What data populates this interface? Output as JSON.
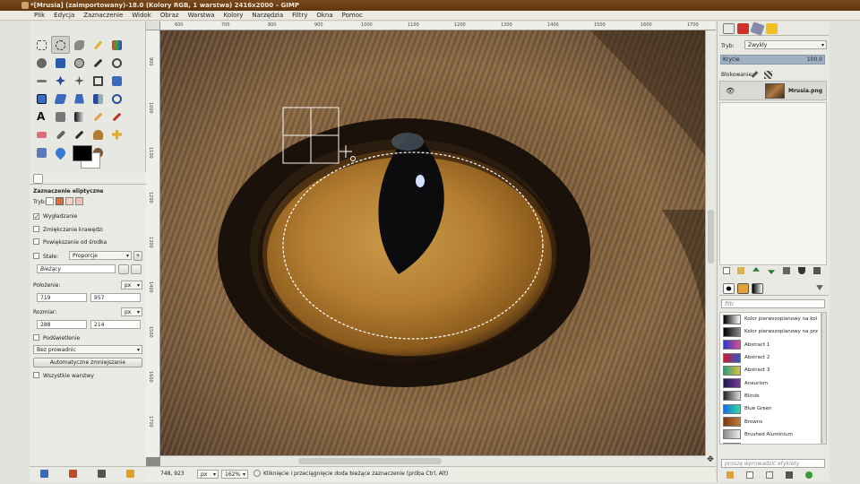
{
  "window": {
    "title": "*[Mrusia] (zaimportowany)-18.0 (Kolory RGB, 1 warstwa) 2416x2000 – GIMP"
  },
  "menu": [
    "Plik",
    "Edycja",
    "Zaznaczenie",
    "Widok",
    "Obraz",
    "Warstwa",
    "Kolory",
    "Narzędzia",
    "Filtry",
    "Okna",
    "Pomoc"
  ],
  "colors": {
    "accent": "#e2a23a",
    "titlebar": "#5c3510"
  },
  "tool_options": {
    "header": "Zaznaczenie eliptyczne",
    "mode_label": "Tryb:",
    "antialias_label": "Wygładzanie",
    "antialias_checked": true,
    "feather_label": "Zmiękczanie krawędzi",
    "expand_label": "Powiększanie od środka",
    "fixed_label": "Stałe:",
    "fixed_value": "Proporcje",
    "current_value": "Bieżący",
    "position_label": "Położenie:",
    "pos_x": "719",
    "pos_y": "957",
    "unit": "px",
    "size_label": "Rozmiar:",
    "size_w": "288",
    "size_h": "214",
    "highlight_label": "Podświetlenie",
    "guides_value": "Bez prowadnic",
    "autoshrink_button": "Automatyczne zmniejszanie",
    "all_layers_label": "Wszystkie warstwy"
  },
  "rulers": {
    "h": [
      "600",
      "700",
      "800",
      "900",
      "1000",
      "1100",
      "1200",
      "1300",
      "1400",
      "1500",
      "1600",
      "1700"
    ],
    "v": [
      "900",
      "1000",
      "1100",
      "1200",
      "1300",
      "1400",
      "1500",
      "1600",
      "1700",
      "1800"
    ]
  },
  "statusbar": {
    "coords": "748, 923",
    "unit": "px",
    "zoom": "162%",
    "message": "Kliknięcie i przeciągnięcie doda bieżące zaznaczenie (próba Ctrl, Alt)"
  },
  "layers": {
    "mode_label": "Tryb:",
    "mode_value": "Zwykły",
    "opacity_label": "Krycie",
    "opacity_value": "100.0",
    "lock_label": "Blokowanie:",
    "layer_name": "Mrusia.png"
  },
  "gradients": {
    "filter_placeholder": "filtr",
    "tag_placeholder": "proszę wprowadzić etykiety",
    "items": [
      {
        "name": "Kolor pierwszoplanowy na kol",
        "c1": "#000000",
        "c2": "#ffffff"
      },
      {
        "name": "Kolor pierwszoplanowy na prz",
        "c1": "#000000",
        "c2": "#888888"
      },
      {
        "name": "Abstract 1",
        "c1": "#2a3ad0",
        "c2": "#e04a8a"
      },
      {
        "name": "Abstract 2",
        "c1": "#d01a2a",
        "c2": "#2a5ad0"
      },
      {
        "name": "Abstract 3",
        "c1": "#2aa07a",
        "c2": "#e0c03a"
      },
      {
        "name": "Aneurism",
        "c1": "#1a1a4a",
        "c2": "#7a3aa0"
      },
      {
        "name": "Blinds",
        "c1": "#222222",
        "c2": "#dddddd"
      },
      {
        "name": "Blue Green",
        "c1": "#1a6ae0",
        "c2": "#2ae0a0"
      },
      {
        "name": "Browns",
        "c1": "#7a3a10",
        "c2": "#c07a3a"
      },
      {
        "name": "Brushed Aluminium",
        "c1": "#8a8a8a",
        "c2": "#eeeeee"
      },
      {
        "name": "Burning Paper",
        "c1": "#ffffff",
        "c2": "#a02a10"
      }
    ]
  }
}
